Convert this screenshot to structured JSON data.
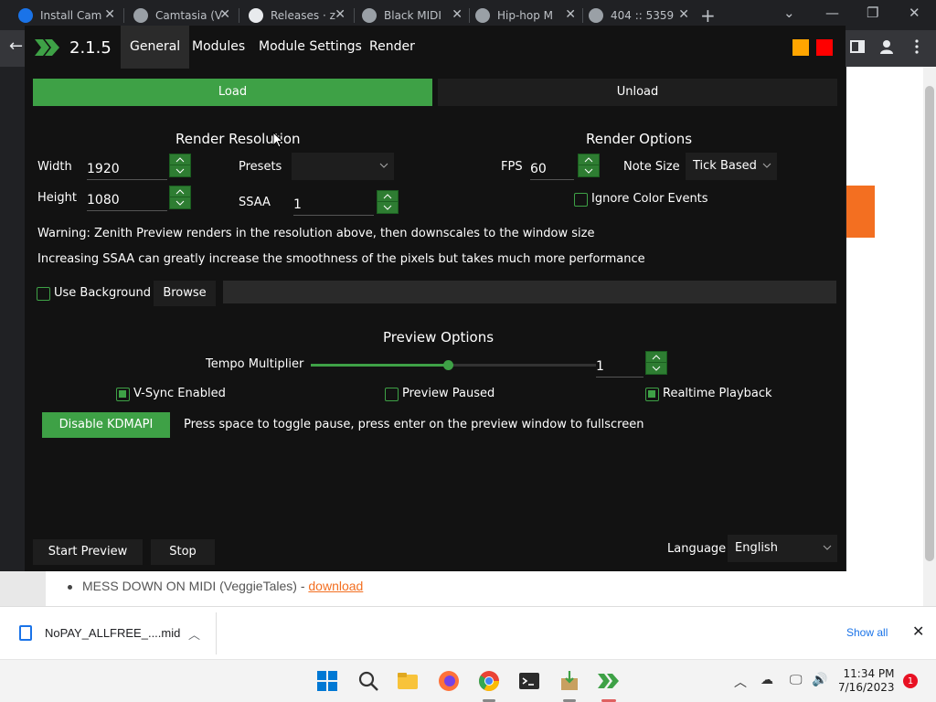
{
  "browser": {
    "tabs": [
      {
        "title": "Install Cam",
        "icon": "globe-icon"
      },
      {
        "title": "Camtasia (V",
        "icon": "globe-icon"
      },
      {
        "title": "Releases · z",
        "icon": "github-icon"
      },
      {
        "title": "Black MIDI",
        "icon": "globe-icon"
      },
      {
        "title": "Hip-hop M",
        "icon": "globe-icon"
      },
      {
        "title": "404 :: 5359",
        "icon": "globe-icon"
      }
    ]
  },
  "app": {
    "version": "2.1.5",
    "menu": [
      "General",
      "Modules",
      "Module Settings",
      "Render"
    ],
    "active_menu": "General",
    "colors": {
      "accent": "#3ea146",
      "window_bg": "#121212",
      "orange": "#ffa500",
      "red": "#ff0000"
    },
    "load_label": "Load",
    "unload_label": "Unload",
    "render_resolution": {
      "title": "Render Resolution",
      "width_label": "Width",
      "width_value": "1920",
      "height_label": "Height",
      "height_value": "1080",
      "presets_label": "Presets",
      "presets_value": "",
      "ssaa_label": "SSAA",
      "ssaa_value": "1"
    },
    "render_options": {
      "title": "Render Options",
      "fps_label": "FPS",
      "fps_value": "60",
      "note_size_label": "Note Size",
      "note_size_value": "Tick Based",
      "ignore_color_events_label": "Ignore Color Events",
      "ignore_color_events_checked": false
    },
    "warning_text": "Warning: Zenith Preview renders in the resolution above, then downscales to the window size",
    "ssaa_info_text": "Increasing SSAA can greatly increase the smoothness of the pixels but takes much more performance",
    "use_background_label": "Use Background",
    "use_background_checked": false,
    "browse_label": "Browse",
    "background_path": "",
    "preview_options": {
      "title": "Preview Options",
      "tempo_label": "Tempo Multiplier",
      "tempo_value": "1",
      "tempo_slider_fraction": 0.48,
      "vsync_label": "V-Sync Enabled",
      "vsync_checked": true,
      "preview_paused_label": "Preview Paused",
      "preview_paused_checked": false,
      "realtime_label": "Realtime Playback",
      "realtime_checked": true
    },
    "kdmapi_button_label": "Disable KDMAPI",
    "hint_text": "Press space to toggle pause, press enter on the preview window to fullscreen",
    "start_preview_label": "Start Preview",
    "stop_label": "Stop",
    "language_label": "Language",
    "language_value": "English"
  },
  "webpage": {
    "list_item_text": "MESS DOWN ON MIDI (VeggieTales) - ",
    "list_item_link": "download"
  },
  "download_bar": {
    "file_name": "NoPAY_ALLFREE_....mid",
    "show_all_label": "Show all"
  },
  "taskbar": {
    "time": "11:34 PM",
    "date": "7/16/2023",
    "notification_count": "1"
  }
}
